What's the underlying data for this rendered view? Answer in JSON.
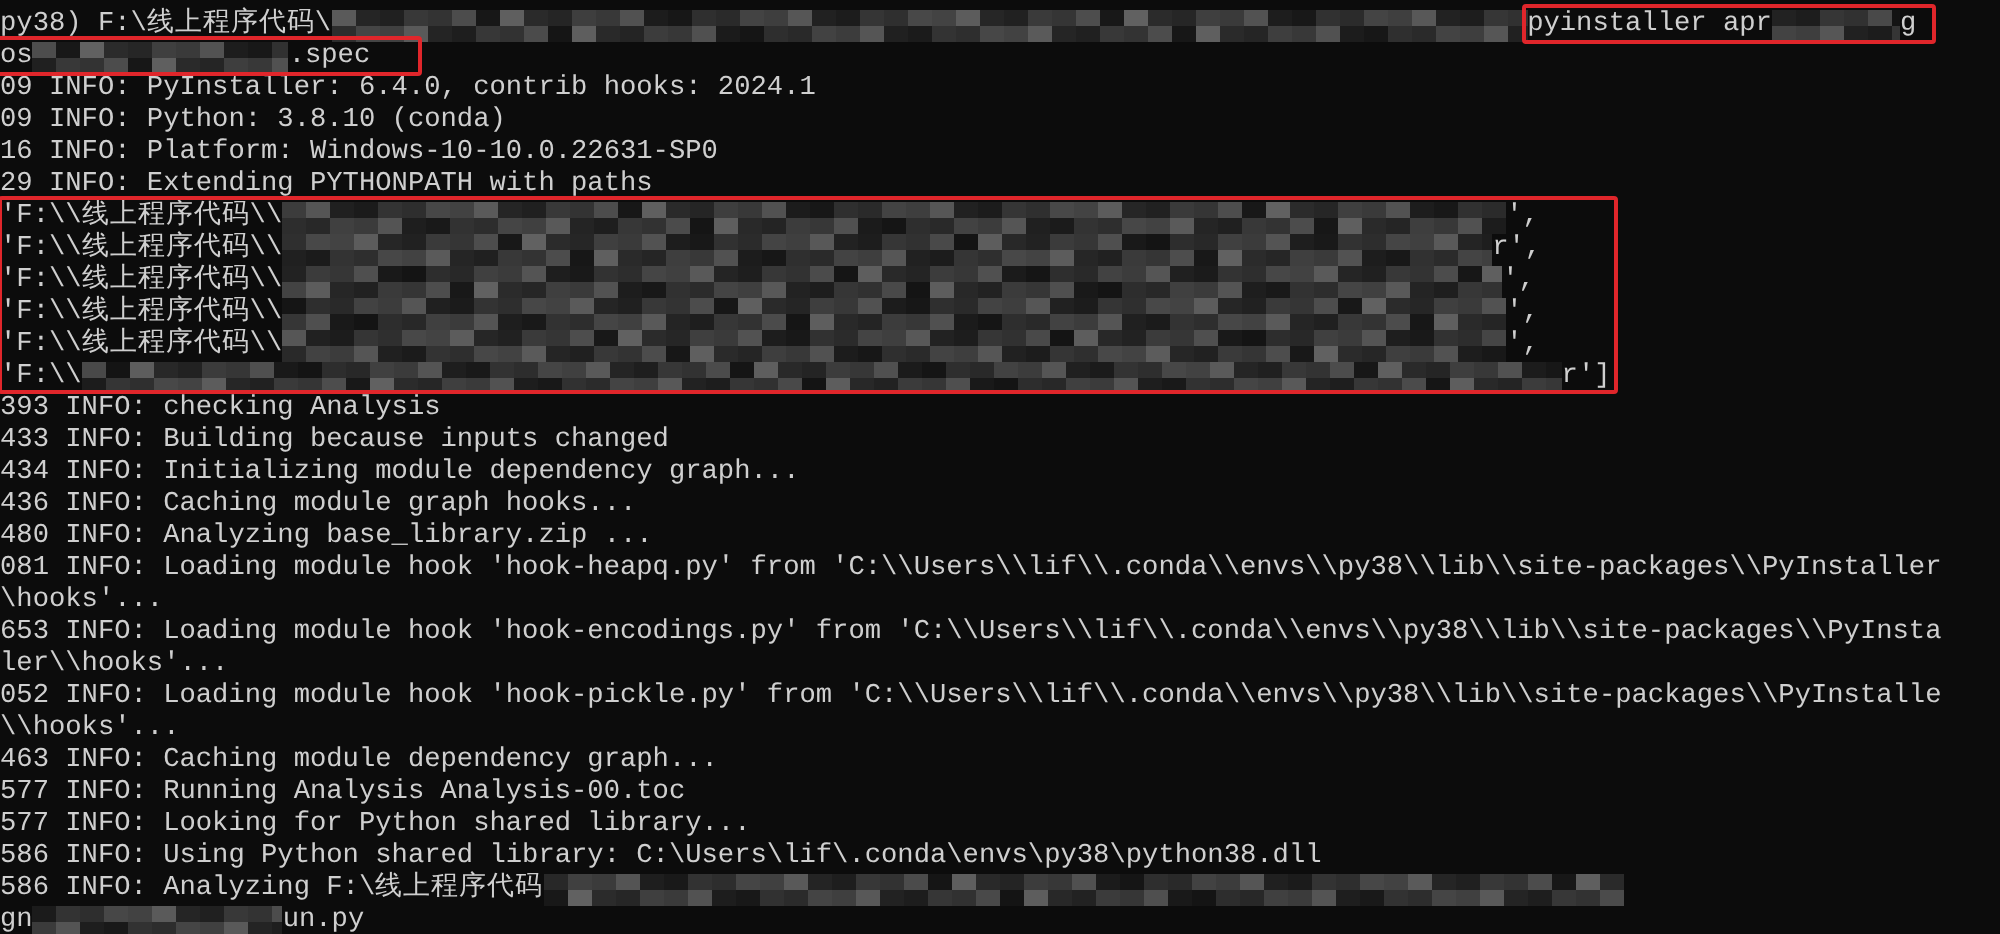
{
  "terminal": {
    "blocks": [
      {
        "kind": "line",
        "segments": [
          {
            "kind": "text",
            "text": "py38) F:\\线上程序代码\\"
          },
          {
            "kind": "redacted"
          },
          {
            "kind": "highlight",
            "segments": [
              {
                "kind": "text",
                "text": "pyinstaller apr"
              },
              {
                "kind": "redacted"
              },
              {
                "kind": "text",
                "text": "g"
              }
            ]
          }
        ]
      },
      {
        "kind": "line",
        "segments": [
          {
            "kind": "highlight",
            "segments": [
              {
                "kind": "text",
                "text": "os"
              },
              {
                "kind": "redacted"
              },
              {
                "kind": "text",
                "text": ".spec"
              }
            ]
          }
        ]
      },
      {
        "kind": "line",
        "segments": [
          {
            "kind": "text",
            "text": "09 INFO: PyInstaller: 6.4.0, contrib hooks: 2024.1"
          }
        ]
      },
      {
        "kind": "line",
        "segments": [
          {
            "kind": "text",
            "text": "09 INFO: Python: 3.8.10 (conda)"
          }
        ]
      },
      {
        "kind": "line",
        "segments": [
          {
            "kind": "text",
            "text": "16 INFO: Platform: Windows-10-10.0.22631-SP0"
          }
        ]
      },
      {
        "kind": "line",
        "segments": [
          {
            "kind": "text",
            "text": "29 INFO: Extending PYTHONPATH with paths"
          }
        ]
      },
      {
        "kind": "highlight",
        "lines": [
          {
            "segments": [
              {
                "kind": "text",
                "text": "'F:\\\\线上程序代码\\\\"
              },
              {
                "kind": "redacted"
              },
              {
                "kind": "text",
                "text": "',"
              }
            ]
          },
          {
            "segments": [
              {
                "kind": "text",
                "text": "'F:\\\\线上程序代码\\\\"
              },
              {
                "kind": "redacted"
              },
              {
                "kind": "text",
                "text": "r',"
              }
            ]
          },
          {
            "segments": [
              {
                "kind": "text",
                "text": "'F:\\\\线上程序代码\\\\"
              },
              {
                "kind": "redacted"
              },
              {
                "kind": "text",
                "text": "',"
              }
            ]
          },
          {
            "segments": [
              {
                "kind": "text",
                "text": "'F:\\\\线上程序代码\\\\"
              },
              {
                "kind": "redacted"
              },
              {
                "kind": "text",
                "text": "',"
              }
            ]
          },
          {
            "segments": [
              {
                "kind": "text",
                "text": "'F:\\\\线上程序代码\\\\"
              },
              {
                "kind": "redacted"
              },
              {
                "kind": "text",
                "text": "',"
              }
            ]
          },
          {
            "segments": [
              {
                "kind": "text",
                "text": "'F:\\\\"
              },
              {
                "kind": "redacted"
              },
              {
                "kind": "text",
                "text": "r']"
              }
            ]
          }
        ]
      },
      {
        "kind": "line",
        "segments": [
          {
            "kind": "text",
            "text": "393 INFO: checking Analysis"
          }
        ]
      },
      {
        "kind": "line",
        "segments": [
          {
            "kind": "text",
            "text": "433 INFO: Building because inputs changed"
          }
        ]
      },
      {
        "kind": "line",
        "segments": [
          {
            "kind": "text",
            "text": "434 INFO: Initializing module dependency graph..."
          }
        ]
      },
      {
        "kind": "line",
        "segments": [
          {
            "kind": "text",
            "text": "436 INFO: Caching module graph hooks..."
          }
        ]
      },
      {
        "kind": "line",
        "segments": [
          {
            "kind": "text",
            "text": "480 INFO: Analyzing base_library.zip ..."
          }
        ]
      },
      {
        "kind": "line",
        "segments": [
          {
            "kind": "text",
            "text": "081 INFO: Loading module hook 'hook-heapq.py' from 'C:\\\\Users\\\\lif\\\\.conda\\\\envs\\\\py38\\\\lib\\\\site-packages\\\\PyInstaller"
          }
        ]
      },
      {
        "kind": "line",
        "segments": [
          {
            "kind": "text",
            "text": "\\hooks'..."
          }
        ]
      },
      {
        "kind": "line",
        "segments": [
          {
            "kind": "text",
            "text": "653 INFO: Loading module hook 'hook-encodings.py' from 'C:\\\\Users\\\\lif\\\\.conda\\\\envs\\\\py38\\\\lib\\\\site-packages\\\\PyInsta"
          }
        ]
      },
      {
        "kind": "line",
        "segments": [
          {
            "kind": "text",
            "text": "ler\\\\hooks'..."
          }
        ]
      },
      {
        "kind": "line",
        "segments": [
          {
            "kind": "text",
            "text": "052 INFO: Loading module hook 'hook-pickle.py' from 'C:\\\\Users\\\\lif\\\\.conda\\\\envs\\\\py38\\\\lib\\\\site-packages\\\\PyInstalle"
          }
        ]
      },
      {
        "kind": "line",
        "segments": [
          {
            "kind": "text",
            "text": "\\\\hooks'..."
          }
        ]
      },
      {
        "kind": "line",
        "segments": [
          {
            "kind": "text",
            "text": "463 INFO: Caching module dependency graph..."
          }
        ]
      },
      {
        "kind": "line",
        "segments": [
          {
            "kind": "text",
            "text": "577 INFO: Running Analysis Analysis-00.toc"
          }
        ]
      },
      {
        "kind": "line",
        "segments": [
          {
            "kind": "text",
            "text": "577 INFO: Looking for Python shared library..."
          }
        ]
      },
      {
        "kind": "line",
        "segments": [
          {
            "kind": "text",
            "text": "586 INFO: Using Python shared library: C:\\Users\\lif\\.conda\\envs\\py38\\python38.dll"
          }
        ]
      },
      {
        "kind": "line",
        "segments": [
          {
            "kind": "text",
            "text": "586 INFO: Analyzing F:\\线上程序代码"
          },
          {
            "kind": "redacted"
          }
        ]
      },
      {
        "kind": "line",
        "segments": [
          {
            "kind": "text",
            "text": "gn"
          },
          {
            "kind": "redacted"
          },
          {
            "kind": "text",
            "text": "un.py"
          }
        ]
      }
    ]
  }
}
